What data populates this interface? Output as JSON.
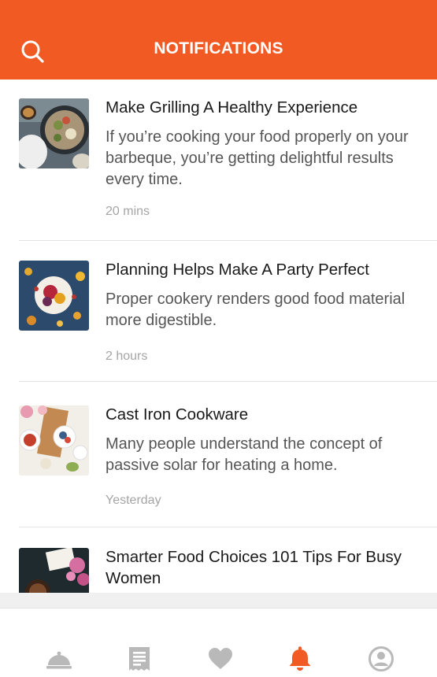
{
  "header": {
    "title": "NOTIFICATIONS",
    "accent": "#f25a24"
  },
  "notifications": [
    {
      "title": "Make Grilling A Healthy Experience",
      "description": "If you’re cooking your food properly on your barbeque, you’re getting delightful results every time.",
      "time": "20 mins",
      "image_icon": "grilled-food-thumbnail"
    },
    {
      "title": "Planning Helps Make A Party Perfect",
      "description": "Proper cookery renders good food material more digestible.",
      "time": "2 hours",
      "image_icon": "party-food-thumbnail"
    },
    {
      "title": "Cast Iron Cookware",
      "description": "Many people understand the concept of passive solar for heating a home.",
      "time": "Yesterday",
      "image_icon": "cookware-thumbnail"
    },
    {
      "title": "Smarter Food Choices 101 Tips For Busy Women",
      "description": "",
      "time": "",
      "image_icon": "coffee-flowers-thumbnail"
    }
  ],
  "tab_bar": {
    "tabs": [
      {
        "icon": "cloche-icon",
        "active": false
      },
      {
        "icon": "receipt-icon",
        "active": false
      },
      {
        "icon": "heart-icon",
        "active": false
      },
      {
        "icon": "bell-icon",
        "active": true
      },
      {
        "icon": "profile-icon",
        "active": false
      }
    ],
    "active_color": "#f25a24",
    "inactive_color": "#b9b9b9"
  }
}
